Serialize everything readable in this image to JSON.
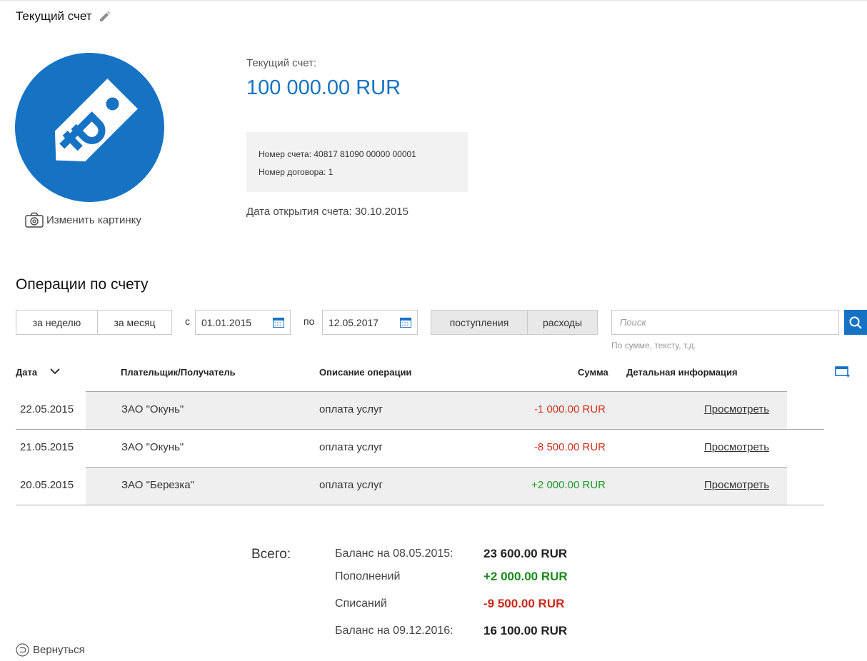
{
  "account": {
    "title": "Текущий счет",
    "change_picture": "Изменить картинку",
    "balance_label": "Текущий счет:",
    "balance_value": "100 000.00 RUR",
    "account_number": "Номер счета: 40817 81090 00000 00001",
    "contract_number": "Номер договора: 1",
    "open_date": "Дата открытия счета: 30.10.2015",
    "avatar_color": "#1673c4"
  },
  "operations": {
    "title": "Операции по счету",
    "filters": {
      "week": "за неделю",
      "month": "за месяц",
      "from_label": "с",
      "from_value": "01.01.2015",
      "to_label": "по",
      "to_value": "12.05.2017",
      "income": "поступления",
      "expenses": "расходы",
      "search_placeholder": "Поиск",
      "search_hint": "По сумме, тексту, т.д."
    },
    "columns": {
      "date": "Дата",
      "party": "Плательщик/Получатель",
      "description": "Описание операции",
      "amount": "Сумма",
      "details": "Детальная информация"
    },
    "rows": [
      {
        "date": "22.05.2015",
        "party": "ЗАО \"Окунь\"",
        "description": "оплата услуг",
        "amount": "-1 000.00 RUR",
        "sign": "neg",
        "details": "Просмотреть"
      },
      {
        "date": "21.05.2015",
        "party": "ЗАО \"Окунь\"",
        "description": "оплата услуг",
        "amount": "-8 500.00 RUR",
        "sign": "neg",
        "details": "Просмотреть"
      },
      {
        "date": "20.05.2015",
        "party": "ЗАО \"Березка\"",
        "description": "оплата услуг",
        "amount": "+2 000.00 RUR",
        "sign": "pos",
        "details": "Просмотреть"
      }
    ]
  },
  "totals": {
    "label": "Всего:",
    "opening_label": "Баланс на 08.05.2015:",
    "opening_value": "23 600.00 RUR",
    "income_label": "Пополнений",
    "income_value": "+2 000.00 RUR",
    "expense_label": "Списаний",
    "expense_value": "-9 500.00 RUR",
    "closing_label": "Баланс на 09.12.2016:",
    "closing_value": "16 100.00 RUR"
  },
  "back_label": "Вернуться",
  "colors": {
    "accent": "#1673c4",
    "negative": "#d0311f",
    "positive": "#1f9a2f"
  }
}
